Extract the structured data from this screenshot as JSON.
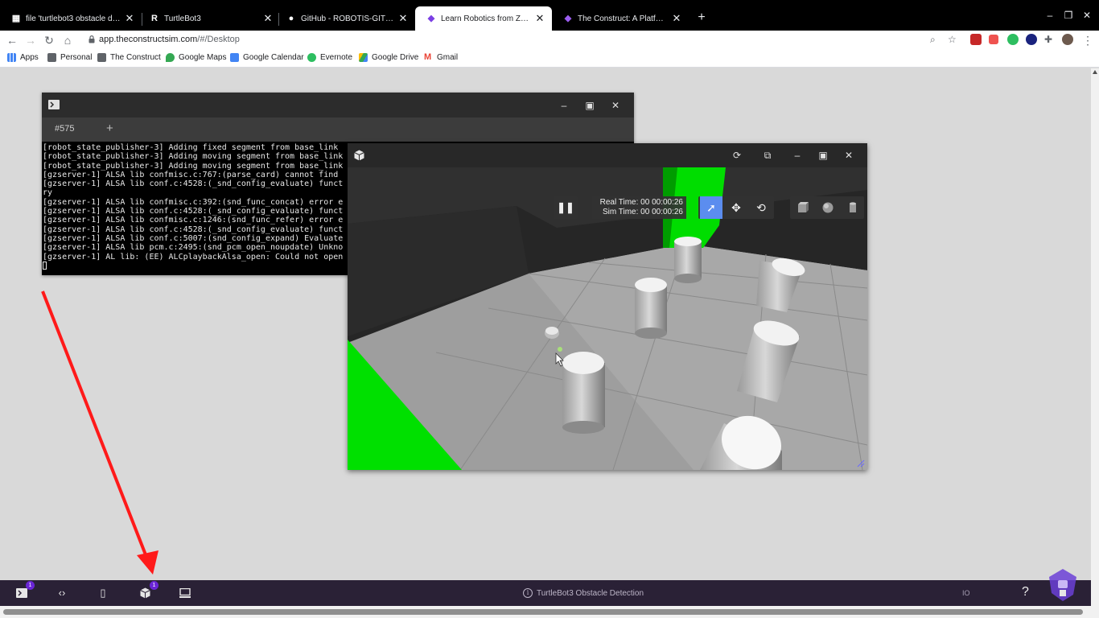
{
  "browser": {
    "tabs": [
      {
        "title": "file 'turtlebot3 obstacle detecti…",
        "icon": "grid-icon",
        "active": false
      },
      {
        "title": "TurtleBot3",
        "icon": "r-logo-icon",
        "active": false
      },
      {
        "title": "GitHub - ROBOTIS-GIT/turtlebo…",
        "icon": "github-icon",
        "active": false
      },
      {
        "title": "Learn Robotics from Zero - Robo…",
        "icon": "construct-logo-icon",
        "active": true
      },
      {
        "title": "The Construct: A Platform to Le…",
        "icon": "construct-logo-icon",
        "active": false
      }
    ],
    "url_host": "app.theconstructsim.com",
    "url_path": "/#/Desktop",
    "bookmarks": [
      {
        "label": "Apps",
        "icon": "apps-grid-icon",
        "color": "#4285f4"
      },
      {
        "label": "Personal",
        "icon": "folder-icon",
        "color": "#5f6368"
      },
      {
        "label": "The Construct",
        "icon": "folder-icon",
        "color": "#5f6368"
      },
      {
        "label": "Google Maps",
        "icon": "maps-pin-icon",
        "color": "#34a853"
      },
      {
        "label": "Google Calendar",
        "icon": "calendar-icon",
        "color": "#4285f4"
      },
      {
        "label": "Evernote",
        "icon": "evernote-icon",
        "color": "#2dbe60"
      },
      {
        "label": "Google Drive",
        "icon": "drive-icon",
        "color": "#fbbc04"
      },
      {
        "label": "Gmail",
        "icon": "gmail-icon",
        "color": "#ea4335"
      }
    ]
  },
  "terminal": {
    "tab_label": "#575",
    "add_label": "+",
    "lines": [
      "[robot_state_publisher-3] Adding fixed segment from base_link",
      "[robot_state_publisher-3] Adding moving segment from base_link",
      "[robot_state_publisher-3] Adding moving segment from base_link",
      "[gzserver-1] ALSA lib confmisc.c:767:(parse_card) cannot find",
      "[gzserver-1] ALSA lib conf.c:4528:(_snd_config_evaluate) funct",
      "ry",
      "[gzserver-1] ALSA lib confmisc.c:392:(snd_func_concat) error e",
      "[gzserver-1] ALSA lib conf.c:4528:(_snd_config_evaluate) funct",
      "[gzserver-1] ALSA lib confmisc.c:1246:(snd_func_refer) error e",
      "[gzserver-1] ALSA lib conf.c:4528:(_snd_config_evaluate) funct",
      "[gzserver-1] ALSA lib conf.c:5007:(snd_config_expand) Evaluate",
      "[gzserver-1] ALSA lib pcm.c:2495:(snd_pcm_open_noupdate) Unkno",
      "[gzserver-1] AL lib: (EE) ALCplaybackAlsa_open: Could not open"
    ]
  },
  "gazebo": {
    "real_time": "Real Time: 00 00:00:26",
    "sim_time": "Sim Time: 00 00:00:26",
    "accent": "#5b8def"
  },
  "dock": {
    "title": "TurtleBot3 Obstacle Detection",
    "io_label": "IO",
    "help_label": "?",
    "terminal_badge": "1",
    "gazebo_badge": "1",
    "background": "#2a2136",
    "badge_color": "#6a25d6"
  },
  "annotation_color": "#ff1a1a"
}
